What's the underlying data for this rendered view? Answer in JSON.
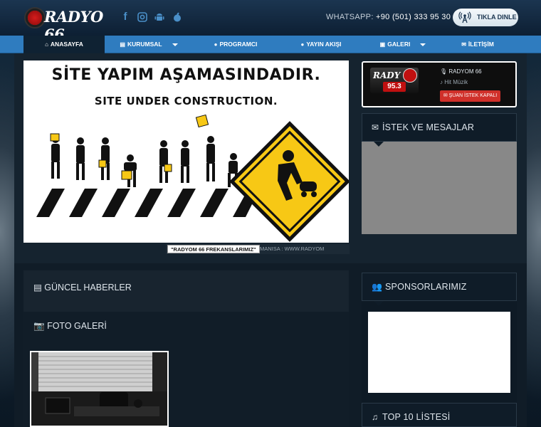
{
  "header": {
    "logo_text": "RADYO 66",
    "whatsapp_label": "WHATSAPP:",
    "whatsapp_number": "+90 (501) 333 95 30",
    "listen_button": "TIKLA DINLE",
    "social_icons": [
      "facebook-icon",
      "instagram-icon",
      "android-icon",
      "apple-icon"
    ]
  },
  "nav": {
    "items": [
      {
        "label": "ANASAYFA",
        "icon": "home-icon"
      },
      {
        "label": "KURUMSAL",
        "icon": "document-icon"
      },
      {
        "label": "PROGRAMCI",
        "icon": "user-icon"
      },
      {
        "label": "YAYIN AKIŞI",
        "icon": "user-icon"
      },
      {
        "label": "GALERI",
        "icon": "film-icon"
      },
      {
        "label": "İLETİŞİM",
        "icon": "envelope-icon"
      }
    ]
  },
  "construction": {
    "line1": "SİTE YAPIM AŞAMASINDADIR.",
    "line2": "SITE UNDER CONSTRUCTION."
  },
  "frequency": {
    "label": "\"RADYOM 66 FREKANSLARIMIZ\"",
    "subtext": "MANISA : WWW.RADYOM"
  },
  "radio_card": {
    "logo_text": "RADY",
    "frequency": "95.3",
    "station_name": "RADYOM 66",
    "genre": "Hit Müzik",
    "request_button": "ŞUAN İSTEK KAPALI"
  },
  "sidebar": {
    "requests_title": "İSTEK VE MESAJLAR",
    "sponsors_title": "SPONSORLARIMIZ",
    "top10_title": "TOP 10 LİSTESİ"
  },
  "main": {
    "news_title": "GÜNCEL HABERLER",
    "gallery_title": "FOTO GALERİ"
  },
  "colors": {
    "nav_blue": "#2f7cbf",
    "header_dark": "#0d1f33",
    "accent_red": "#d0302a",
    "sign_yellow": "#f7c815"
  }
}
